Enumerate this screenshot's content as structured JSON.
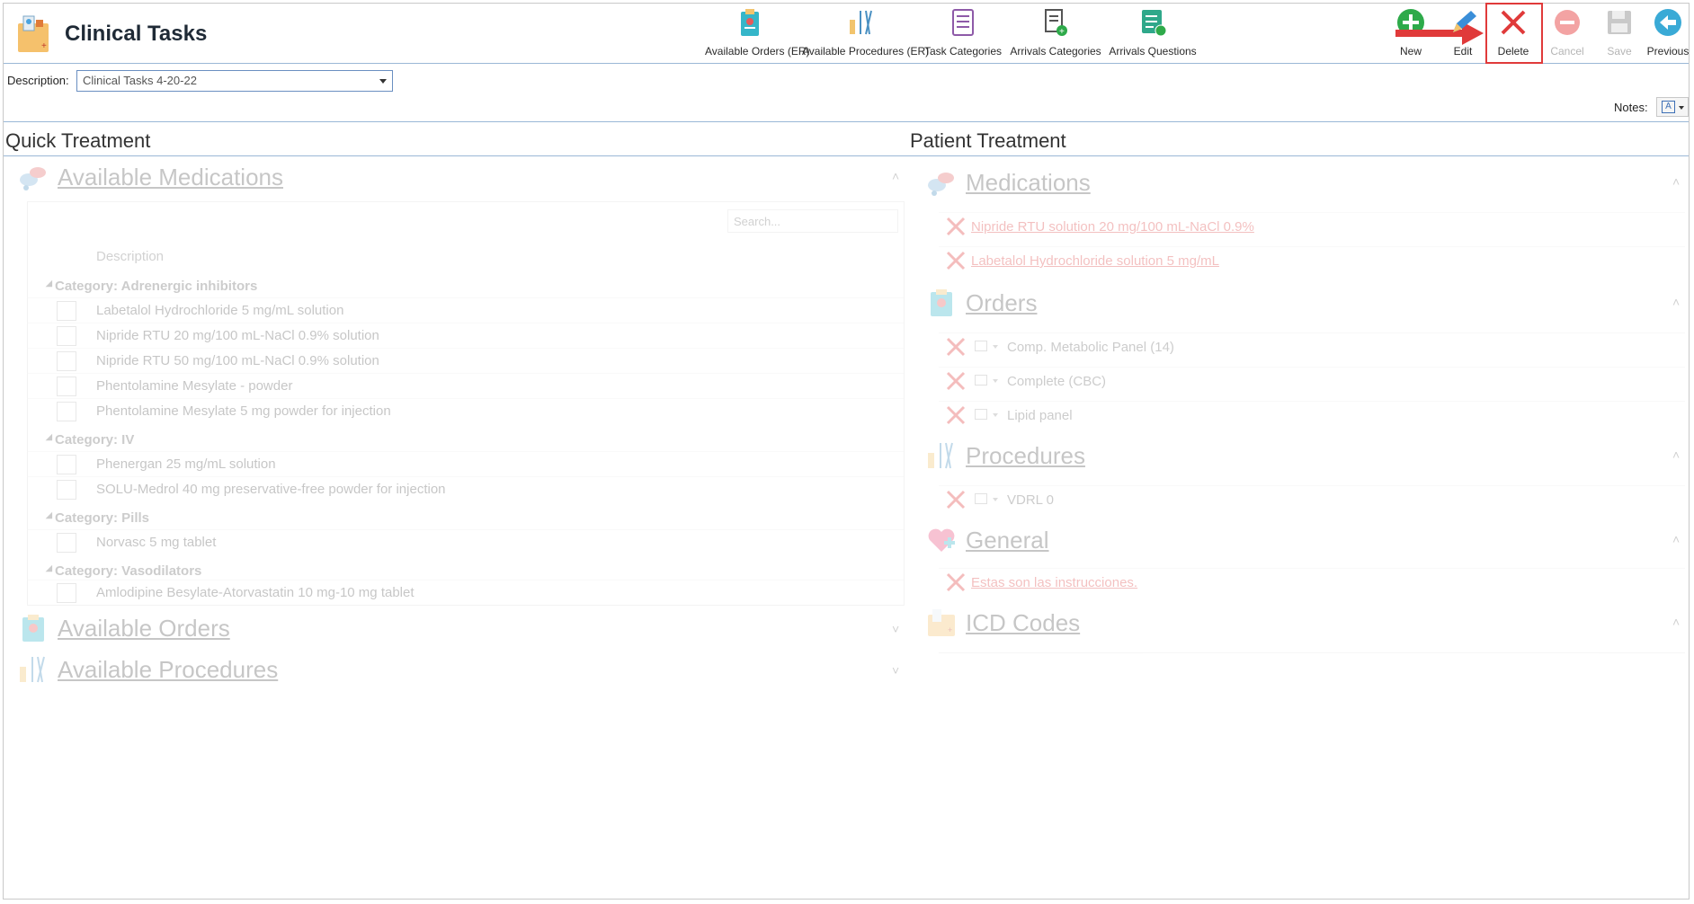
{
  "app": {
    "title": "Clinical Tasks"
  },
  "toolbar": {
    "available_orders": "Available Orders (ER)",
    "available_procedures": "Available Procedures (ER)",
    "task_categories": "Task Categories",
    "arrivals_categories": "Arrivals Categories",
    "arrivals_questions": "Arrivals Questions",
    "new": "New",
    "edit": "Edit",
    "delete": "Delete",
    "cancel": "Cancel",
    "save": "Save",
    "previous": "Previous"
  },
  "description": {
    "label": "Description:",
    "value": "Clinical Tasks 4-20-22"
  },
  "notes": {
    "label": "Notes:"
  },
  "quick_treatment": {
    "title": "Quick Treatment",
    "available_medications": "Available Medications",
    "search_placeholder": "Search...",
    "column_description": "Description",
    "categories": [
      {
        "name": "Category: Adrenergic inhibitors",
        "items": [
          "Labetalol Hydrochloride 5 mg/mL solution",
          "Nipride RTU 20 mg/100 mL-NaCl 0.9% solution",
          "Nipride RTU 50 mg/100 mL-NaCl 0.9% solution",
          "Phentolamine Mesylate - powder",
          "Phentolamine Mesylate 5 mg powder for injection"
        ]
      },
      {
        "name": "Category: IV",
        "items": [
          "Phenergan 25 mg/mL solution",
          "SOLU-Medrol 40 mg preservative-free powder for injection"
        ]
      },
      {
        "name": "Category: Pills",
        "items": [
          "Norvasc 5 mg tablet"
        ]
      },
      {
        "name": "Category: Vasodilators",
        "items": [
          "Amlodipine Besylate-Atorvastatin 10 mg-10 mg tablet"
        ]
      }
    ],
    "available_orders": "Available Orders",
    "available_procedures": "Available Procedures"
  },
  "patient_treatment": {
    "title": "Patient Treatment",
    "medications": {
      "title": "Medications",
      "items": [
        "Nipride RTU solution 20 mg/100 mL-NaCl 0.9%",
        "Labetalol Hydrochloride solution 5 mg/mL"
      ]
    },
    "orders": {
      "title": "Orders",
      "items": [
        "Comp. Metabolic Panel (14)",
        "Complete (CBC)",
        "Lipid panel"
      ]
    },
    "procedures": {
      "title": "Procedures",
      "items": [
        "VDRL 0"
      ]
    },
    "general": {
      "title": "General",
      "items": [
        "Estas son las instrucciones."
      ]
    },
    "icd_codes": {
      "title": "ICD Codes"
    }
  },
  "colors": {
    "accent": "#2b6cb0",
    "delete_red": "#e03a3a",
    "new_green": "#2eaa4a"
  }
}
